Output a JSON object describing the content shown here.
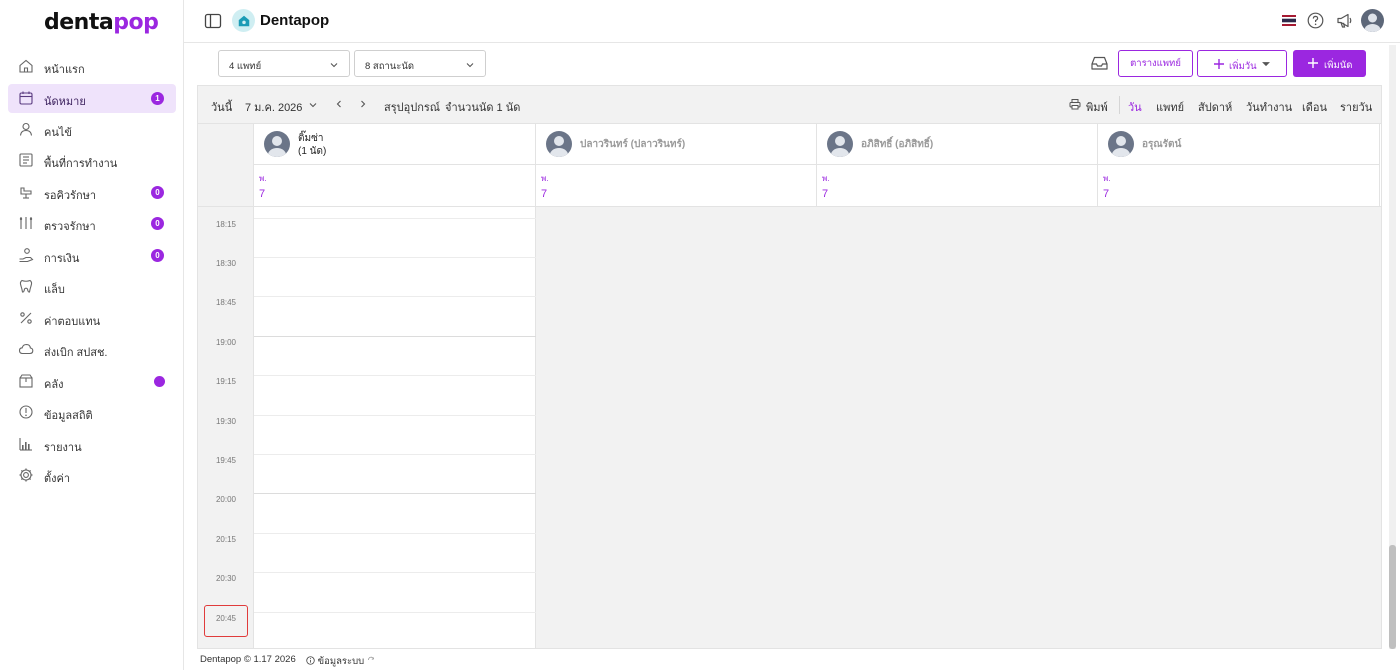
{
  "brand": {
    "logo_dark": "denta",
    "logo_accent": "pop",
    "accent_color": "#9b27e0"
  },
  "sidebar": {
    "items": [
      {
        "label": "หน้าแรก",
        "icon": "home-icon"
      },
      {
        "label": "นัดหมาย",
        "icon": "calendar-icon",
        "badge": "1",
        "active": true
      },
      {
        "label": "คนไข้",
        "icon": "user-icon"
      },
      {
        "label": "พื้นที่การทำงาน",
        "icon": "workspace-icon"
      },
      {
        "label": "รอคิวรักษา",
        "icon": "dental-chair-icon",
        "badge": "0"
      },
      {
        "label": "ตรวจรักษา",
        "icon": "tools-icon",
        "badge": "0"
      },
      {
        "label": "การเงิน",
        "icon": "money-hand-icon",
        "badge": "0"
      },
      {
        "label": "แล็บ",
        "icon": "tooth-icon"
      },
      {
        "label": "ค่าตอบแทน",
        "icon": "percent-icon"
      },
      {
        "label": "ส่งเบิก สปสช.",
        "icon": "cloud-icon"
      },
      {
        "label": "คลัง",
        "icon": "box-icon",
        "dot": true
      },
      {
        "label": "ข้อมูลสถิติ",
        "icon": "stats-icon"
      },
      {
        "label": "รายงาน",
        "icon": "report-chart-icon"
      },
      {
        "label": "ตั้งค่า",
        "icon": "gear-icon"
      }
    ]
  },
  "header": {
    "app_title": "Dentapop"
  },
  "filters": {
    "doctors": "4 แพทย์",
    "stations": "8 สถานะนัด"
  },
  "actions": {
    "doctor_schedule": "ตารางแพทย์",
    "add_day": "เพิ่มวัน",
    "add_appointment": "เพิ่มนัด"
  },
  "toolbar": {
    "today": "วันนี้",
    "date": "7 ม.ค. 2026",
    "equipment_summary": "สรุปอุปกรณ์",
    "appointment_count": "จำนวนนัด 1 นัด",
    "print": "พิมพ์",
    "views": [
      "วัน",
      "แพทย์",
      "สัปดาห์",
      "วันทำงาน",
      "เดือน",
      "รายวัน"
    ],
    "active_view": "วัน"
  },
  "resources": [
    {
      "name": "ติ๊มซ่า",
      "sub": "(1 นัด)",
      "day": "พ.",
      "date": "7",
      "active": true
    },
    {
      "name": "ปลาวรินทร์ (ปลาวรินทร์)",
      "sub": "",
      "day": "พ.",
      "date": "7",
      "active": false
    },
    {
      "name": "อภิสิทธิ์ (อภิสิทธิ์)",
      "sub": "",
      "day": "พ.",
      "date": "7",
      "active": false
    },
    {
      "name": "อรุณรัตน์",
      "sub": "",
      "day": "พ.",
      "date": "7",
      "active": false
    }
  ],
  "time_slots": [
    "18:15",
    "18:30",
    "18:45",
    "19:00",
    "19:15",
    "19:30",
    "19:45",
    "20:00",
    "20:15",
    "20:30",
    "20:45"
  ],
  "footer": {
    "copyright": "Dentapop © 1.17 2026",
    "system_info": "ข้อมูลระบบ"
  }
}
